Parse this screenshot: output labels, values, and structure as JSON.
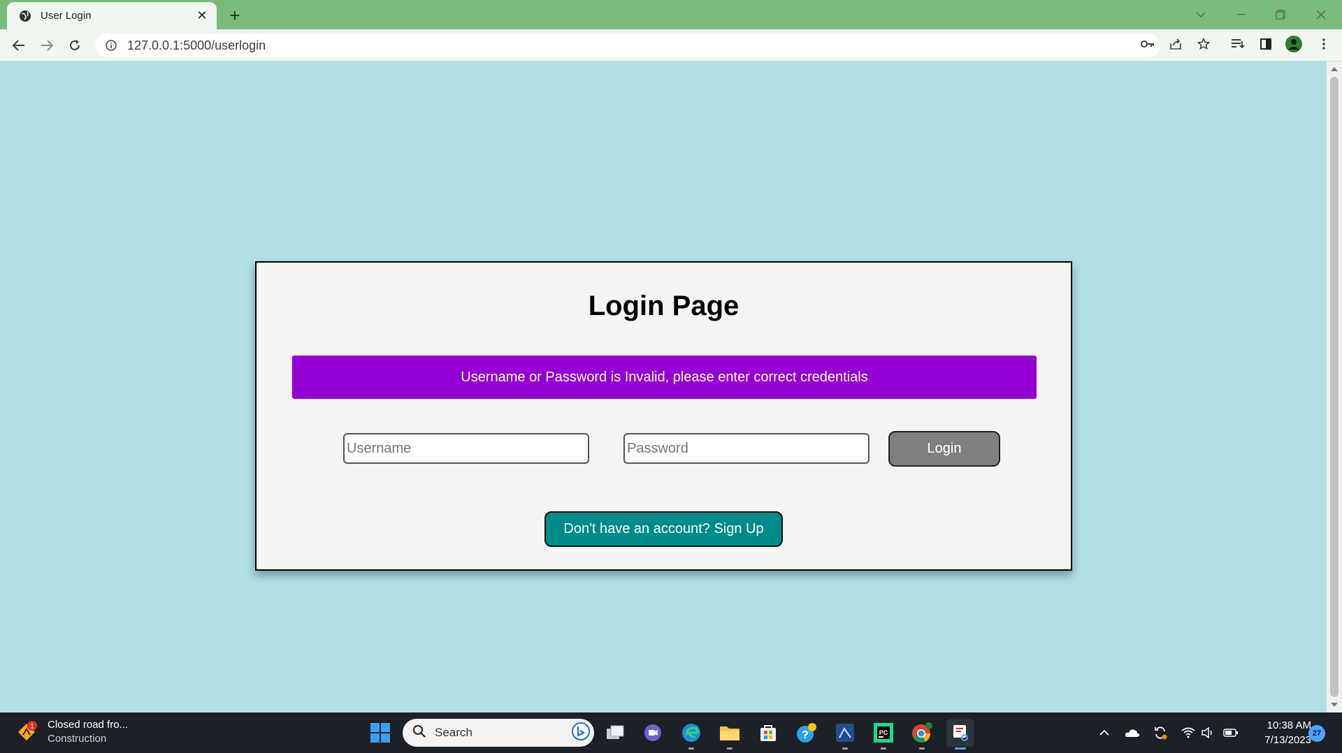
{
  "browser": {
    "tab_title": "User Login",
    "url": "127.0.0.1:5000/userlogin"
  },
  "page": {
    "title": "Login Page",
    "error_message": "Username or Password is Invalid, please enter correct credentials",
    "username_placeholder": "Username",
    "password_placeholder": "Password",
    "login_label": "Login",
    "signup_label": "Don't have an account? Sign Up"
  },
  "colors": {
    "background": "#b0dfe5",
    "alert": "#9400d3",
    "login_button": "#808080",
    "signup_button": "#008b8b"
  },
  "taskbar": {
    "weather_title": "Closed road fro...",
    "weather_subtitle": "Construction",
    "weather_badge": "1",
    "search_label": "Search",
    "time": "10:38 AM",
    "date": "7/13/2023",
    "notification_count": "27",
    "apps": [
      "start-icon",
      "task-view-icon",
      "chat-icon",
      "edge-icon",
      "file-explorer-icon",
      "store-icon",
      "help-icon",
      "vscode-icon",
      "pycharm-icon",
      "chrome-icon",
      "snipping-tool-icon"
    ]
  }
}
